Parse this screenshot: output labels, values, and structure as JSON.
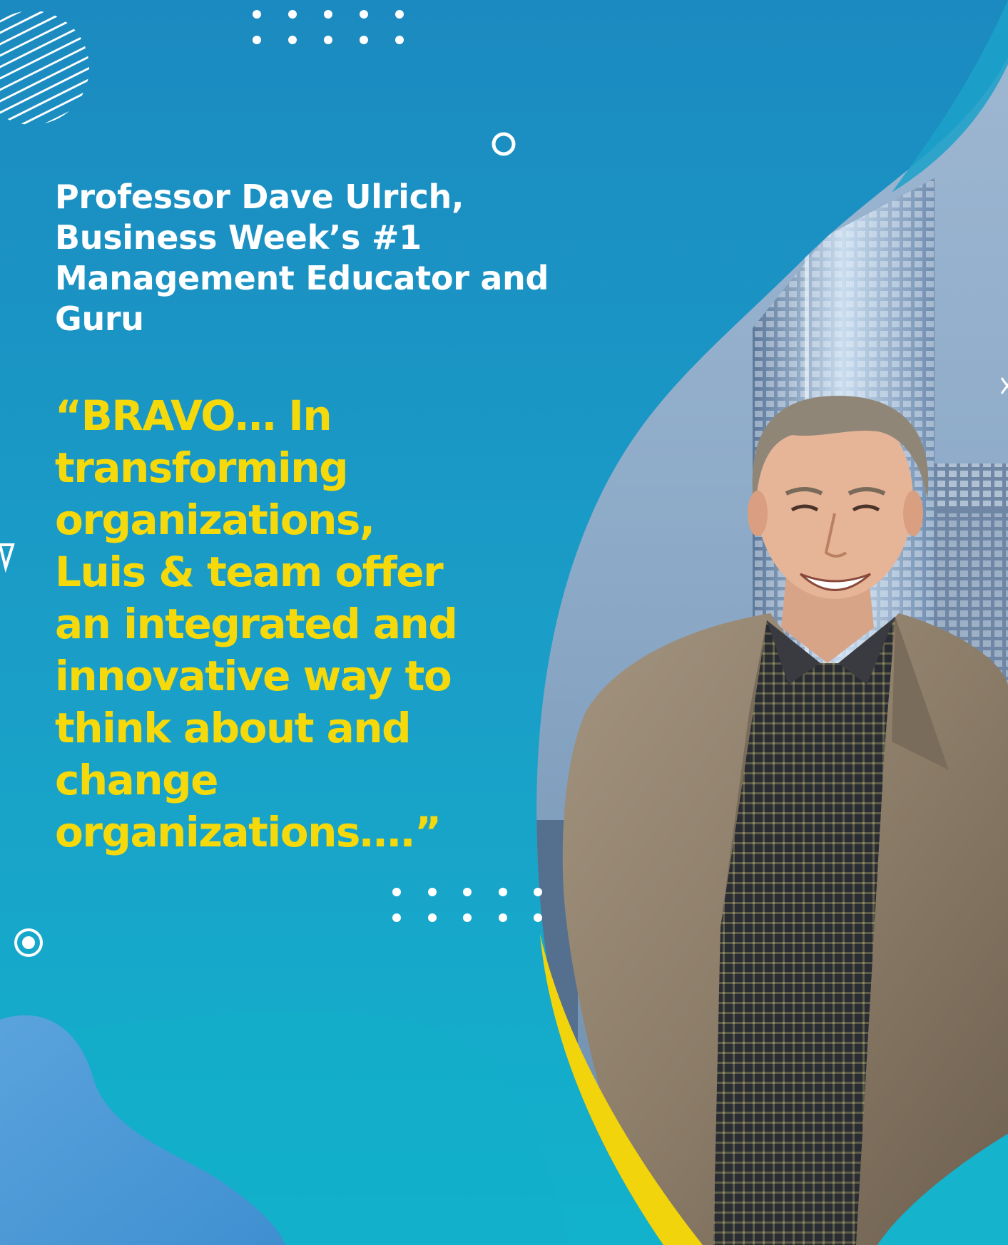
{
  "attribution": {
    "lines": [
      "Professor Dave Ulrich,",
      "Business Week’s #1",
      "Management Educator and",
      "Guru"
    ]
  },
  "quote": {
    "lines": [
      "“BRAVO… In",
      "transforming",
      "organizations,",
      "Luis & team offer",
      "an integrated and",
      "innovative way to",
      "think about and",
      "change",
      "organizations….”"
    ]
  },
  "colors": {
    "background": "#1e93c4",
    "background_light": "#13aecb",
    "quote_text": "#f5d90a",
    "attribution_text": "#ffffff",
    "accent_curve": "#f2d40c",
    "lower_blob": "#4f9ed8"
  },
  "decorations": {
    "photo_subject": "portrait of a smiling man in tweed jacket with city skyscraper background",
    "icons": [
      "striped-circle",
      "dot-grid",
      "ring",
      "target-ring",
      "triangle-outline",
      "cross"
    ]
  }
}
